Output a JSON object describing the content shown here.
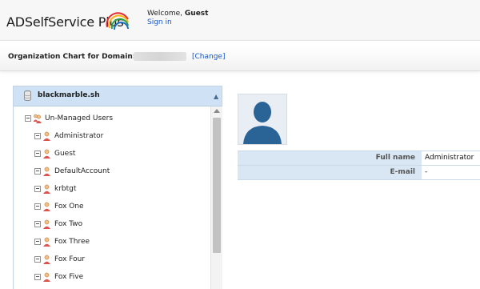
{
  "header": {
    "brand_name": "ADSelfService Plus",
    "welcome_prefix": "Welcome,",
    "user_name": "Guest",
    "signin_label": "Sign in"
  },
  "domain_bar": {
    "label": "Organization Chart for Domain:",
    "change_label": "[Change]"
  },
  "tree": {
    "root_label": "blackmarble.sh",
    "group_label": "Un-Managed Users",
    "users": [
      "Administrator",
      "Guest",
      "DefaultAccount",
      "krbtgt",
      "Fox One",
      "Fox Two",
      "Fox Three",
      "Fox Four",
      "Fox Five"
    ]
  },
  "details": {
    "rows": [
      {
        "label": "Full name",
        "value": "Administrator"
      },
      {
        "label": "E-mail",
        "value": "-"
      }
    ]
  },
  "icons": [
    "database-icon",
    "user-group-icon",
    "user-icon",
    "avatar-placeholder-icon",
    "collapse-icon"
  ],
  "colors": {
    "tree_header_bg": "#cfe1f4",
    "detail_label_bg": "#d9e7f5",
    "link": "#1155cc",
    "avatar_silhouette": "#2a6395"
  }
}
